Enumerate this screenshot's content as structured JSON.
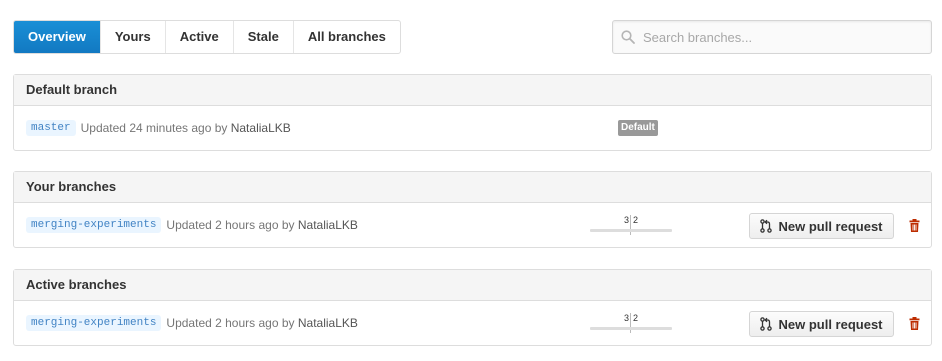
{
  "tabs": [
    {
      "label": "Overview",
      "selected": true
    },
    {
      "label": "Yours",
      "selected": false
    },
    {
      "label": "Active",
      "selected": false
    },
    {
      "label": "Stale",
      "selected": false
    },
    {
      "label": "All branches",
      "selected": false
    }
  ],
  "search": {
    "placeholder": "Search branches...",
    "value": "",
    "icon": "search-icon"
  },
  "sections": {
    "default": {
      "title": "Default branch",
      "branch": {
        "name": "master",
        "updated": "Updated 24 minutes ago by",
        "author": "NataliaLKB",
        "badge": "Default"
      }
    },
    "yours": {
      "title": "Your branches",
      "branch": {
        "name": "merging-experiments",
        "updated": "Updated 2 hours ago by",
        "author": "NataliaLKB",
        "behind": "3",
        "ahead": "2",
        "pr_label": "New pull request"
      }
    },
    "active": {
      "title": "Active branches",
      "branch": {
        "name": "merging-experiments",
        "updated": "Updated 2 hours ago by",
        "author": "NataliaLKB",
        "behind": "3",
        "ahead": "2",
        "pr_label": "New pull request"
      }
    }
  },
  "colors": {
    "accent": "#1a8fd6",
    "branch_link": "#4183c4",
    "delete": "#bd2c00",
    "badge": "#999999"
  },
  "icons": {
    "pull_request": "git-pull-request-icon",
    "delete": "trash-icon"
  }
}
